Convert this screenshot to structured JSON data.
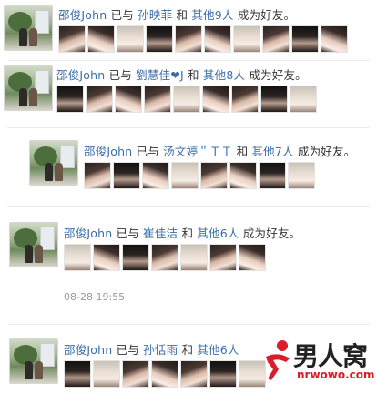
{
  "feed": [
    {
      "user": "邵俊John",
      "verb": "已与",
      "friend": "孙映菲",
      "and": "和",
      "others": "其他9人",
      "suffix": "成为好友。",
      "thumb_count": 10
    },
    {
      "user": "邵俊John",
      "verb": "已与",
      "friend": "劉慧佳❤J",
      "and": "和",
      "others": "其他8人",
      "suffix": "成为好友。",
      "thumb_count": 9
    },
    {
      "user": "邵俊John",
      "verb": "已与",
      "friend": "汤文婷＂ＴＴ",
      "and": "和",
      "others": "其他7人",
      "suffix": "成为好友。",
      "thumb_count": 8
    },
    {
      "user": "邵俊John",
      "verb": "已与",
      "friend": "崔佳洁",
      "and": "和",
      "others": "其他6人",
      "suffix": "成为好友。",
      "thumb_count": 7,
      "timestamp": "08-28 19:55"
    },
    {
      "user": "邵俊John",
      "verb": "已与",
      "friend": "孙恬雨",
      "and": "和",
      "others": "其他6人",
      "suffix": "",
      "thumb_count": 7
    }
  ],
  "watermark": {
    "logo_text": "男人窝",
    "site": "nrwowo.com",
    "accent": "#d81e2a"
  },
  "colors": {
    "link": "#3b6ea8",
    "text": "#333333",
    "muted": "#9a9a9a"
  }
}
